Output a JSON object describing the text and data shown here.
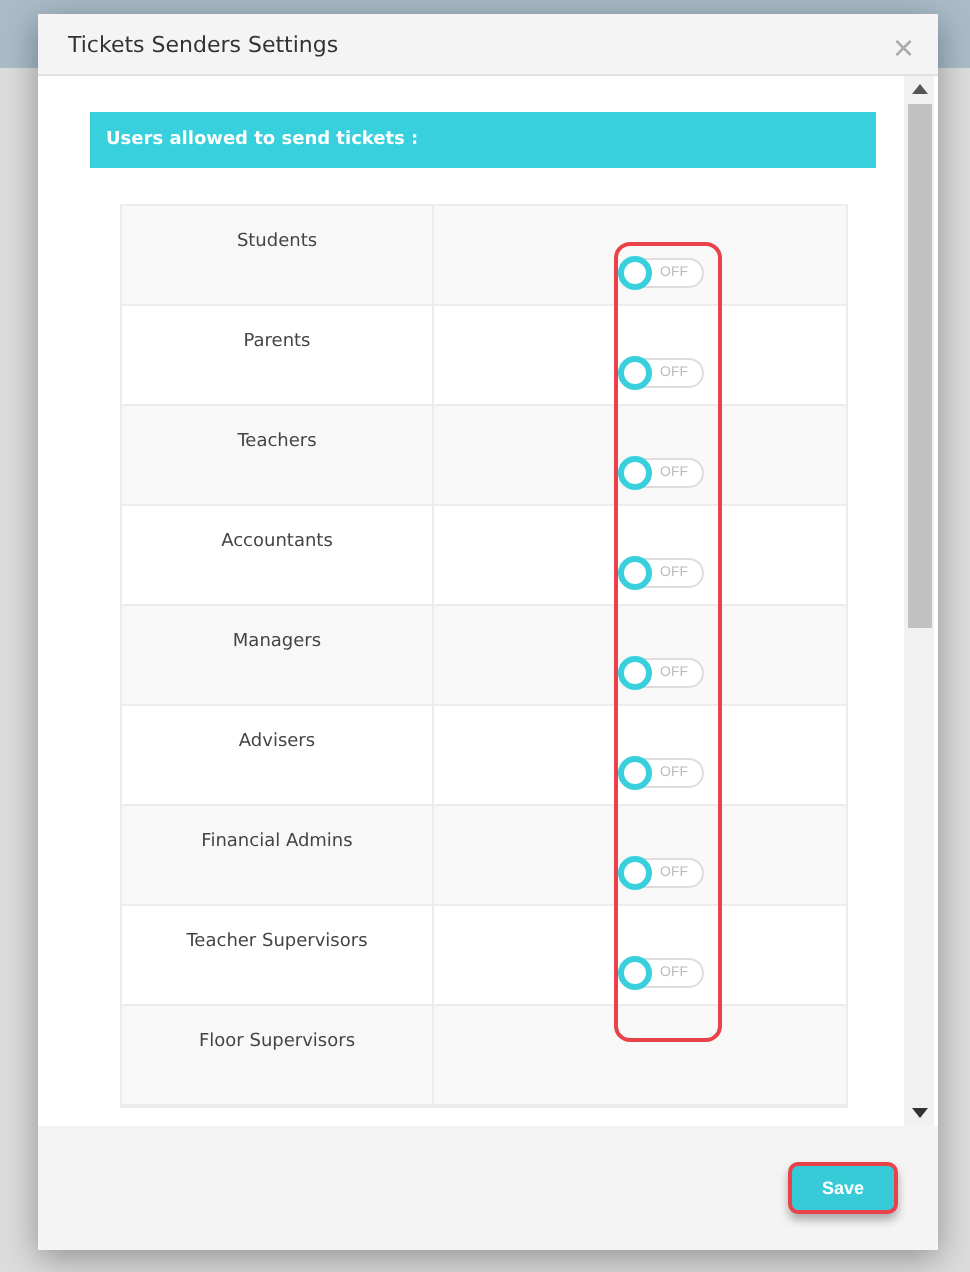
{
  "dialog": {
    "title": "Tickets Senders Settings",
    "close": "×"
  },
  "section_heading": "Users allowed to send tickets :",
  "rows": [
    {
      "label": "Students",
      "on": false,
      "state_text": "OFF"
    },
    {
      "label": "Parents",
      "on": false,
      "state_text": "OFF"
    },
    {
      "label": "Teachers",
      "on": false,
      "state_text": "OFF"
    },
    {
      "label": "Accountants",
      "on": false,
      "state_text": "OFF"
    },
    {
      "label": "Managers",
      "on": false,
      "state_text": "OFF"
    },
    {
      "label": "Advisers",
      "on": false,
      "state_text": "OFF"
    },
    {
      "label": "Financial Admins",
      "on": false,
      "state_text": "OFF"
    },
    {
      "label": "Teacher Supervisors",
      "on": false,
      "state_text": "OFF"
    },
    {
      "label": "Floor Supervisors"
    }
  ],
  "buttons": [
    {
      "label": "Save"
    }
  ]
}
